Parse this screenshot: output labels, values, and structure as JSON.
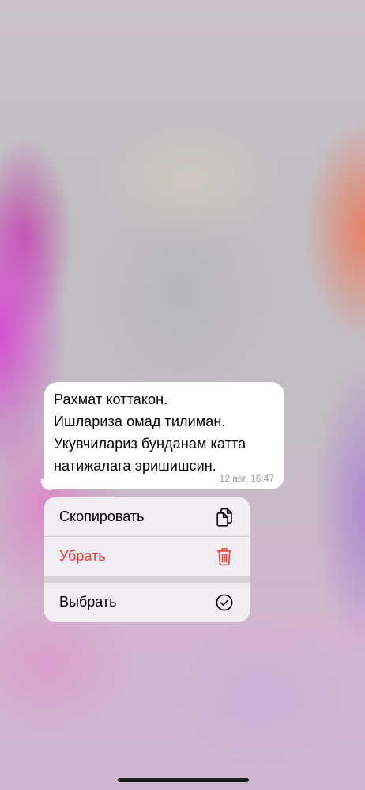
{
  "message": {
    "text": "Рахмат коттакон.\nИшлариза омад тилиман.\nУкувчилариз бунданам катта натижалага эришишсин.",
    "time": "12 авг, 16:47"
  },
  "context_menu": {
    "items": [
      {
        "label": "Скопировать",
        "icon": "copy-icon"
      },
      {
        "label": "Убрать",
        "icon": "trash-icon",
        "color": "#e6403a"
      },
      {
        "label": "Выбрать",
        "icon": "checkmark-circle-icon"
      }
    ]
  },
  "colors": {
    "destructive": "#e6403a",
    "bubble": "#ffffff",
    "time": "#9e9e9e"
  }
}
